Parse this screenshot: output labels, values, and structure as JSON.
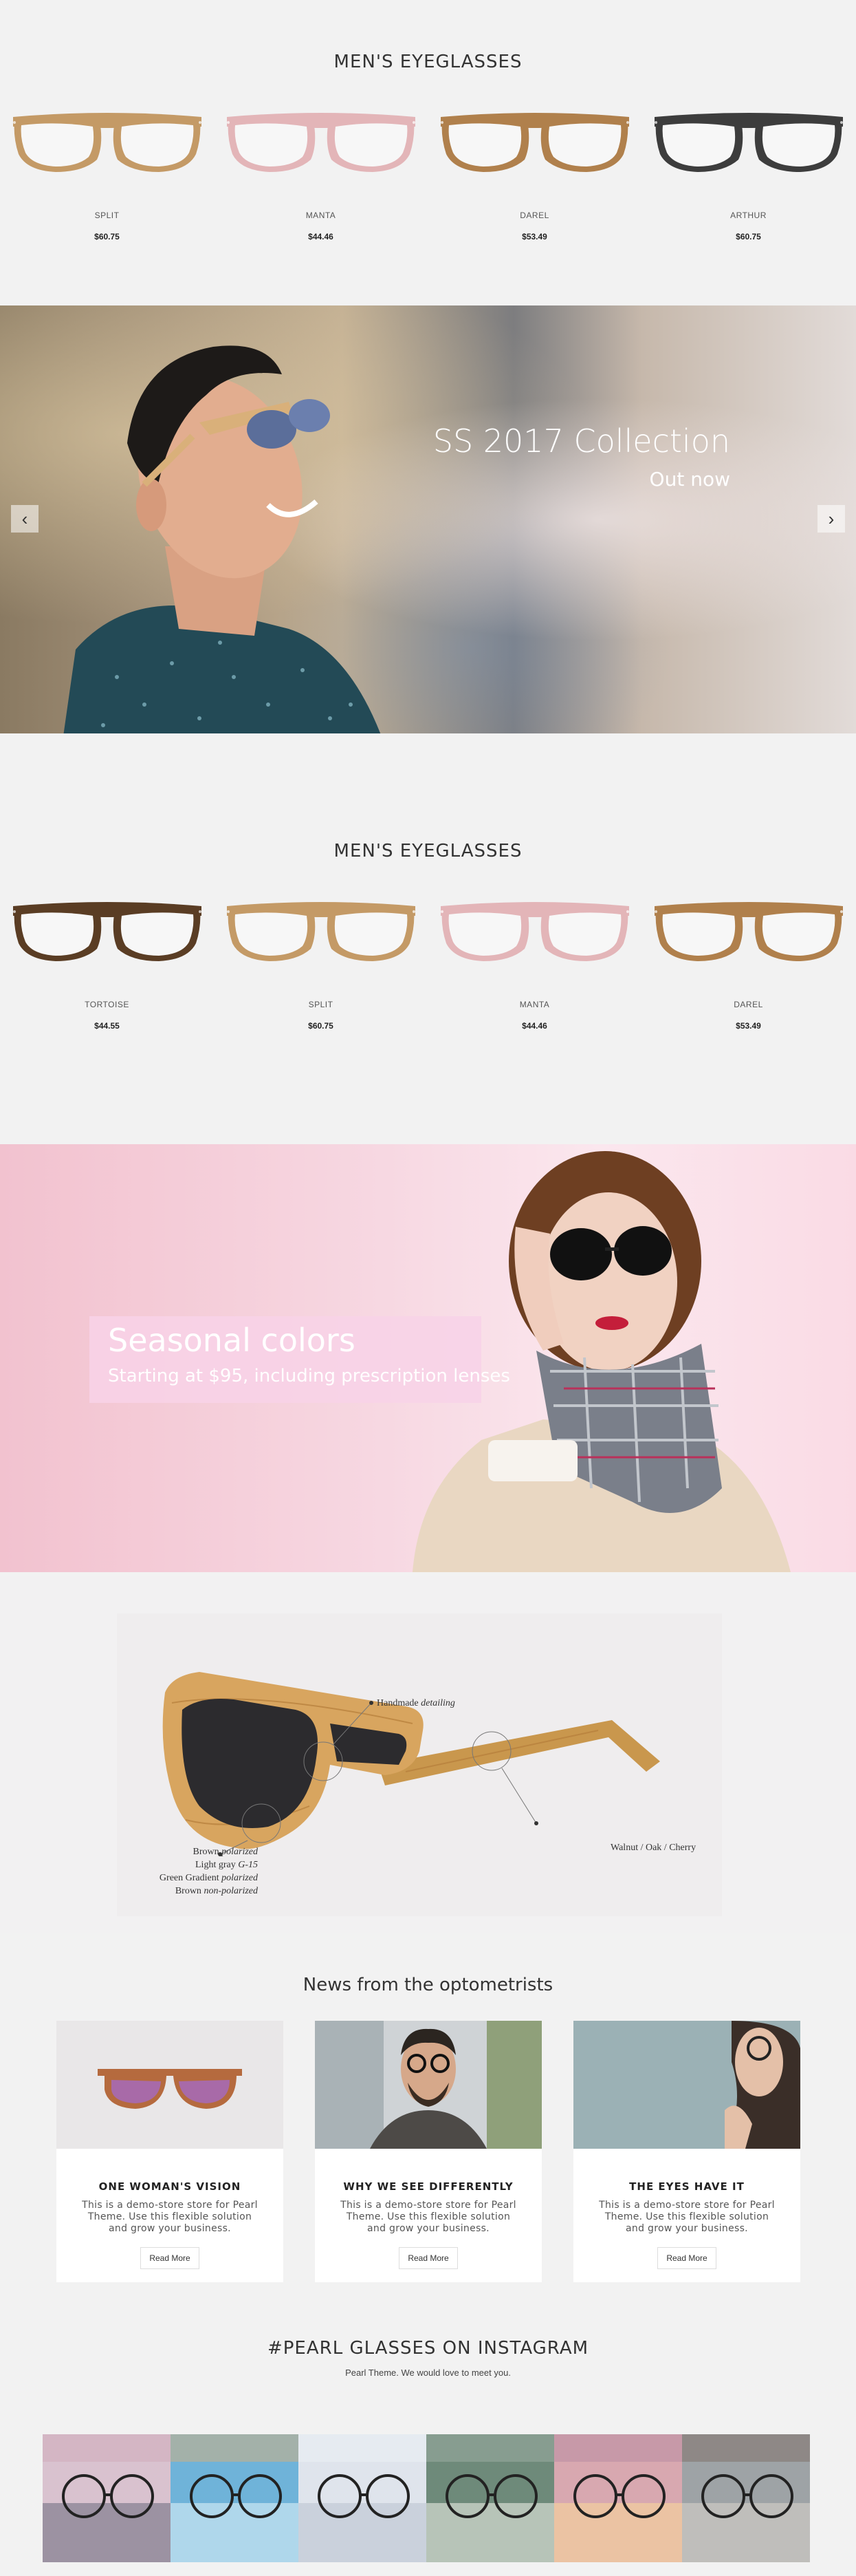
{
  "section1": {
    "title": "MEN'S EYEGLASSES",
    "products": [
      {
        "name": "SPLIT",
        "price": "$60.75",
        "frame_color": "#c49a66"
      },
      {
        "name": "MANTA",
        "price": "$44.46",
        "frame_color": "#e3b5b8"
      },
      {
        "name": "DAREL",
        "price": "$53.49",
        "frame_color": "#b0804c"
      },
      {
        "name": "ARTHUR",
        "price": "$60.75",
        "frame_color": "#3d3d3d"
      }
    ]
  },
  "slider": {
    "title": "SS 2017 Collection",
    "subtitle": "Out now",
    "prev_icon": "chevron-left-icon",
    "next_icon": "chevron-right-icon"
  },
  "section2": {
    "title": "MEN'S EYEGLASSES",
    "products": [
      {
        "name": "TORTOISE",
        "price": "$44.55",
        "frame_color": "#5a3d24"
      },
      {
        "name": "SPLIT",
        "price": "$60.75",
        "frame_color": "#c49a66"
      },
      {
        "name": "MANTA",
        "price": "$44.46",
        "frame_color": "#e3b5b8"
      },
      {
        "name": "DAREL",
        "price": "$53.49",
        "frame_color": "#b0804c"
      }
    ]
  },
  "seasonal": {
    "title": "Seasonal colors",
    "subtitle": "Starting at $95, including prescription lenses"
  },
  "detail": {
    "handmade": "Handmade",
    "handmade_em": "detailing",
    "wood": "Walnut / Oak / Cherry",
    "lens_lines": [
      {
        "main": "Brown",
        "em": "polarized"
      },
      {
        "main": "Light gray",
        "em": "G-15"
      },
      {
        "main": "Green Gradient",
        "em": "polarized"
      },
      {
        "main": "Brown",
        "em": "non-polarized"
      }
    ]
  },
  "news": {
    "title": "News from the optometrists",
    "cards": [
      {
        "title": "ONE WOMAN'S VISION",
        "text": "This is a demo-store store for Pearl Theme. Use this flexible solution and grow your business.",
        "button": "Read More"
      },
      {
        "title": "WHY WE SEE DIFFERENTLY",
        "text": "This is a demo-store store for Pearl Theme. Use this flexible solution and grow your business.",
        "button": "Read More"
      },
      {
        "title": "THE EYES HAVE IT",
        "text": "This is a demo-store store for Pearl Theme. Use this flexible solution and grow your business.",
        "button": "Read More"
      }
    ]
  },
  "instagram": {
    "title": "#PEARL GLASSES ON INSTAGRAM",
    "subtitle": "Pearl Theme. We would love to meet you."
  },
  "colors": {
    "background": "#f2f2f2",
    "seasonal_pink": "#f7d8e2",
    "card_bg": "#ffffff"
  }
}
